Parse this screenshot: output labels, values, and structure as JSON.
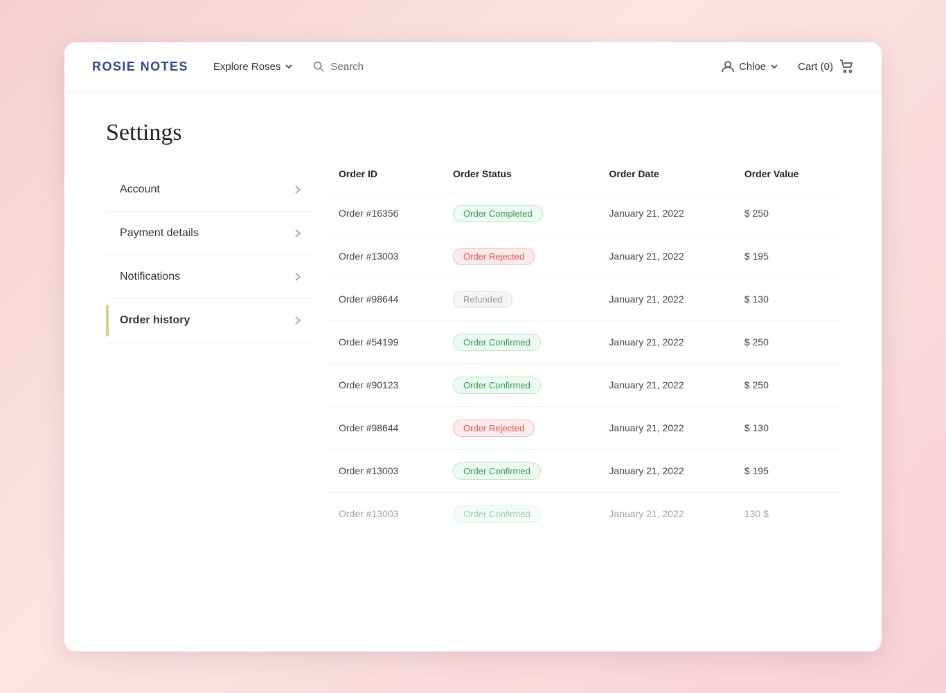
{
  "brand": "ROSIE NOTES",
  "nav": {
    "explore_label": "Explore Roses",
    "search_label": "Search",
    "user_label": "Chloe",
    "cart_label": "Cart (0)"
  },
  "page": {
    "title": "Settings"
  },
  "sidebar": {
    "items": [
      {
        "label": "Account",
        "active": false
      },
      {
        "label": "Payment details",
        "active": false
      },
      {
        "label": "Notifications",
        "active": false
      },
      {
        "label": "Order history",
        "active": true
      }
    ]
  },
  "table": {
    "headers": [
      "Order ID",
      "Order Status",
      "Order Date",
      "Order Value"
    ],
    "rows": [
      {
        "id": "Order #16356",
        "status": "Order Completed",
        "status_type": "completed",
        "date": "January 21, 2022",
        "value": "$ 250"
      },
      {
        "id": "Order #13003",
        "status": "Order Rejected",
        "status_type": "rejected",
        "date": "January 21, 2022",
        "value": "$ 195"
      },
      {
        "id": "Order #98644",
        "status": "Refunded",
        "status_type": "refunded",
        "date": "January 21, 2022",
        "value": "$ 130"
      },
      {
        "id": "Order #54199",
        "status": "Order Confirmed",
        "status_type": "confirmed",
        "date": "January 21, 2022",
        "value": "$ 250"
      },
      {
        "id": "Order #90123",
        "status": "Order Confirmed",
        "status_type": "confirmed",
        "date": "January 21, 2022",
        "value": "$ 250"
      },
      {
        "id": "Order #98644",
        "status": "Order Rejected",
        "status_type": "rejected",
        "date": "January 21, 2022",
        "value": "$ 130"
      },
      {
        "id": "Order #13003",
        "status": "Order Confirmed",
        "status_type": "confirmed",
        "date": "January 21, 2022",
        "value": "$ 195"
      },
      {
        "id": "Order #13003",
        "status": "Order Confirmed",
        "status_type": "confirmed",
        "date": "January 21, 2022",
        "value": "130 $"
      }
    ]
  }
}
